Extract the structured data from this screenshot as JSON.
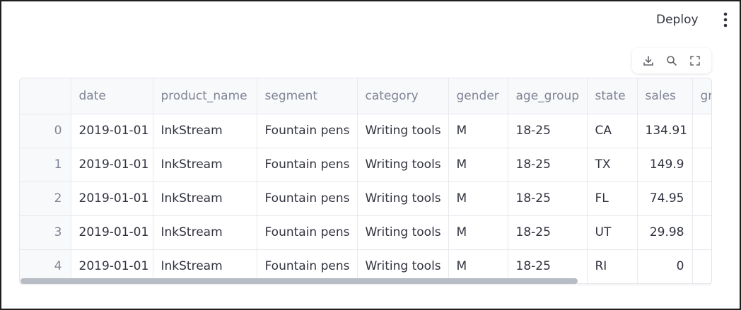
{
  "header": {
    "deploy_label": "Deploy",
    "menu_icon": "vertical-ellipsis-icon"
  },
  "toolbar": {
    "icons": [
      "download-icon",
      "search-icon",
      "fullscreen-icon"
    ]
  },
  "table": {
    "columns": [
      "",
      "date",
      "product_name",
      "segment",
      "category",
      "gender",
      "age_group",
      "state",
      "sales",
      "gr"
    ],
    "rows": [
      {
        "index": "0",
        "date": "2019-01-01",
        "product_name": "InkStream",
        "segment": "Fountain pens",
        "category": "Writing tools",
        "gender": "M",
        "age_group": "18-25",
        "state": "CA",
        "sales": "134.91"
      },
      {
        "index": "1",
        "date": "2019-01-01",
        "product_name": "InkStream",
        "segment": "Fountain pens",
        "category": "Writing tools",
        "gender": "M",
        "age_group": "18-25",
        "state": "TX",
        "sales": "149.9"
      },
      {
        "index": "2",
        "date": "2019-01-01",
        "product_name": "InkStream",
        "segment": "Fountain pens",
        "category": "Writing tools",
        "gender": "M",
        "age_group": "18-25",
        "state": "FL",
        "sales": "74.95"
      },
      {
        "index": "3",
        "date": "2019-01-01",
        "product_name": "InkStream",
        "segment": "Fountain pens",
        "category": "Writing tools",
        "gender": "M",
        "age_group": "18-25",
        "state": "UT",
        "sales": "29.98"
      },
      {
        "index": "4",
        "date": "2019-01-01",
        "product_name": "InkStream",
        "segment": "Fountain pens",
        "category": "Writing tools",
        "gender": "M",
        "age_group": "18-25",
        "state": "RI",
        "sales": "0"
      }
    ]
  },
  "colors": {
    "header_bg": "#f8f9fb",
    "border": "#e8e9ed",
    "text": "#31333f",
    "muted_text": "#808495",
    "scrollbar": "#b8bcc4"
  }
}
